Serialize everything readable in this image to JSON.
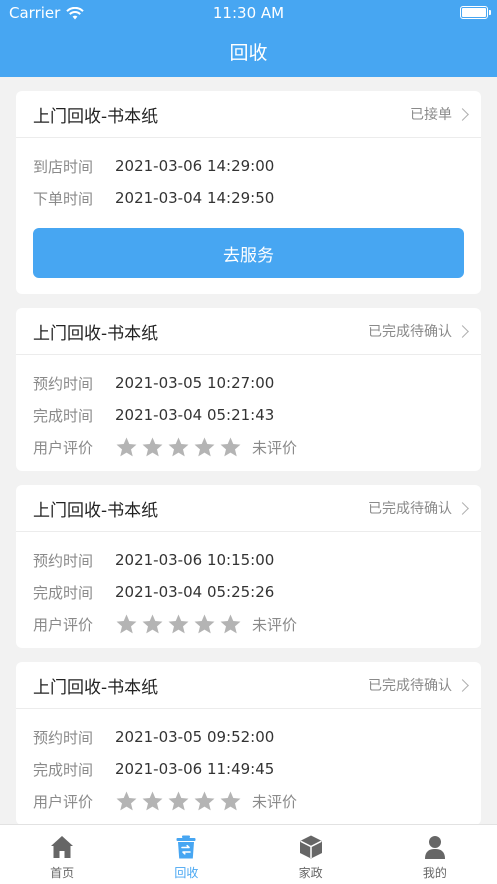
{
  "status_bar": {
    "carrier": "Carrier",
    "time": "11:30 AM"
  },
  "header": {
    "title": "回收"
  },
  "orders": [
    {
      "title": "上门回收-书本纸",
      "status": "已接单",
      "rows": [
        {
          "label": "到店时间",
          "value": "2021-03-06 14:29:00"
        },
        {
          "label": "下单时间",
          "value": "2021-03-04 14:29:50"
        }
      ],
      "action": "去服务"
    },
    {
      "title": "上门回收-书本纸",
      "status": "已完成待确认",
      "rows": [
        {
          "label": "预约时间",
          "value": "2021-03-05 10:27:00"
        },
        {
          "label": "完成时间",
          "value": "2021-03-04 05:21:43"
        }
      ],
      "rating_label": "用户评价",
      "rating_value": 0,
      "rating_max": 5,
      "rating_text": "未评价"
    },
    {
      "title": "上门回收-书本纸",
      "status": "已完成待确认",
      "rows": [
        {
          "label": "预约时间",
          "value": "2021-03-06 10:15:00"
        },
        {
          "label": "完成时间",
          "value": "2021-03-04 05:25:26"
        }
      ],
      "rating_label": "用户评价",
      "rating_value": 0,
      "rating_max": 5,
      "rating_text": "未评价"
    },
    {
      "title": "上门回收-书本纸",
      "status": "已完成待确认",
      "rows": [
        {
          "label": "预约时间",
          "value": "2021-03-05 09:52:00"
        },
        {
          "label": "完成时间",
          "value": "2021-03-06 11:49:45"
        }
      ],
      "rating_label": "用户评价",
      "rating_value": 0,
      "rating_max": 5,
      "rating_text": "未评价"
    }
  ],
  "tabs": [
    {
      "label": "首页",
      "icon": "home-icon",
      "active": false
    },
    {
      "label": "回收",
      "icon": "recycle-bin-icon",
      "active": true
    },
    {
      "label": "家政",
      "icon": "box-icon",
      "active": false
    },
    {
      "label": "我的",
      "icon": "user-icon",
      "active": false
    }
  ],
  "colors": {
    "primary": "#47a6f2",
    "background": "#f2f2f2",
    "muted": "#8a8a8a",
    "star": "#b4b4b4",
    "tab_inactive": "#666666"
  }
}
